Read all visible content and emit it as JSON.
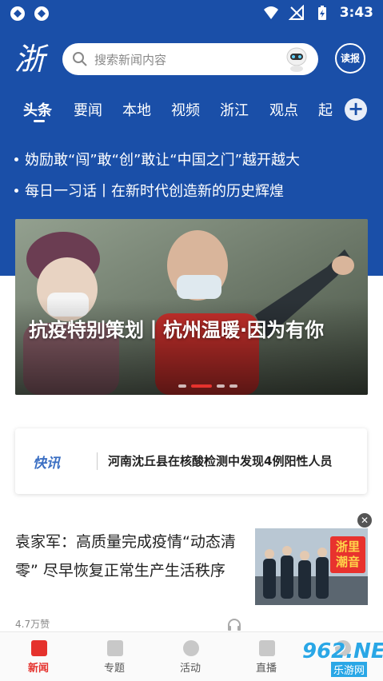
{
  "status_bar": {
    "time": "3:43"
  },
  "header": {
    "logo_text": "浙",
    "search_placeholder": "搜索新闻内容",
    "read_button_label": "读报"
  },
  "tabs": [
    {
      "label": "头条",
      "active": true
    },
    {
      "label": "要闻"
    },
    {
      "label": "本地"
    },
    {
      "label": "视频"
    },
    {
      "label": "浙江"
    },
    {
      "label": "观点"
    },
    {
      "label": "起"
    }
  ],
  "ticker": [
    "妫励敢“闯”敢“创”敢让“中国之门”越开越大",
    "每日一习话丨在新时代创造新的历史辉煌"
  ],
  "banner": {
    "title": "抗疫特别策划丨杭州温暖·因为有你",
    "slide_count": 4,
    "active_slide": 1
  },
  "flash": {
    "brand": "快讯",
    "text": "河南沈丘县在核酸检测中发现4例阳性人员"
  },
  "news_item": {
    "title": "袁家军：高质量完成疫情“动态清零” 尽早恢复正常生产生活秩序",
    "likes": "4.7万赞",
    "thumb_badge": "浙里潮音"
  },
  "bottom_nav": [
    {
      "label": "新闻",
      "active": true
    },
    {
      "label": "专题"
    },
    {
      "label": "活动"
    },
    {
      "label": "直播"
    },
    {
      "label": "我的"
    }
  ],
  "watermark": {
    "brand": "962.NET",
    "sub": "乐游网"
  },
  "colors": {
    "brand_blue": "#1a4fa8",
    "accent_red": "#e5322d"
  }
}
